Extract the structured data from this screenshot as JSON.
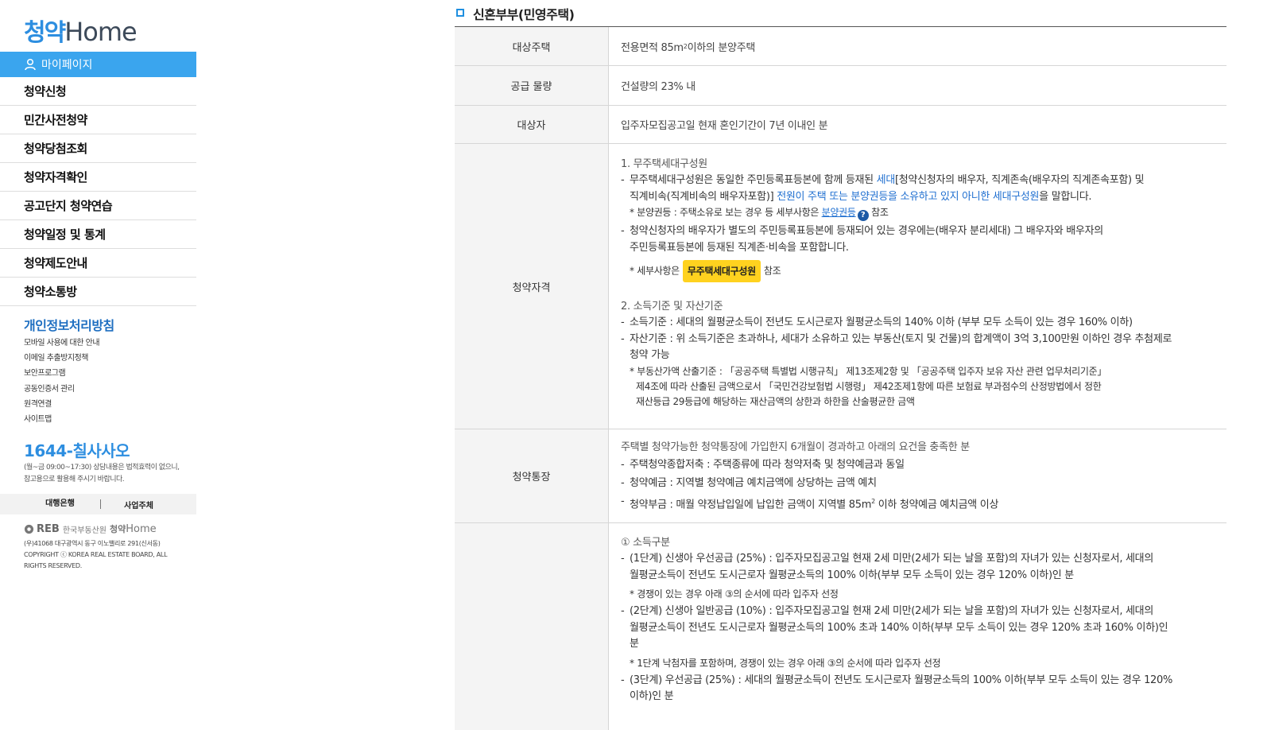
{
  "logo": {
    "ko": "청약",
    "en": "Home"
  },
  "sidebar": {
    "mypage_label": "마이페이지",
    "menu": [
      "청약신청",
      "민간사전청약",
      "청약당첨조회",
      "청약자격확인",
      "공고단지 청약연습",
      "청약일정 및 통계",
      "청약제도안내",
      "청약소통방"
    ],
    "privacy_title": "개인정보처리방침",
    "sublinks": [
      "모바일 사용에 대한 안내",
      "이메일 추출방지정책",
      "보안프로그램",
      "공동인증서 관리",
      "원격연결",
      "사이트맵"
    ],
    "phone": "1644-칠사사오",
    "phone_note": "(월~금 09:00~17:30) 상담내용은 법적효력이 없으니, 참고용으로 활용해 주시기 바랍니다.",
    "bank_label": "대행은행",
    "developer_label": "사업주체",
    "footer_logo": {
      "reb": "REB",
      "org": "한국부동산원",
      "ko": "청약",
      "en": "Home"
    },
    "address": "(우)41068 대구광역시 동구 이노밸리로 291(신서동)",
    "copyright": "COPYRIGHT ⓒ KOREA REAL ESTATE BOARD, ALL RIGHTS RESERVED."
  },
  "main": {
    "section_title": "신혼부부(민영주택)",
    "rows": {
      "target_housing": {
        "th": "대상주택",
        "text_a": "전용면적 85m",
        "sup": "2",
        "text_b": " 이하의 분양주택"
      },
      "supply": {
        "th": "공급 물량",
        "text": "건설량의 23% 내"
      },
      "target": {
        "th": "대상자",
        "text": "입주자모집공고일 현재 혼인기간이 7년 이내인 분"
      },
      "qual": {
        "th": "청약자격",
        "h1": "1. 무주택세대구성원",
        "b1_a": "무주택세대구성원은 동일한 주민등록표등본에 함께 등재된 ",
        "b1_link": "세대",
        "b1_b": "[청약신청자의 배우자, 직계존속(배우자의 직계존속포함) 및",
        "b1_c": "직계비속(직계비속의 배우자포함)] ",
        "b1_link2": "전원이 주택 또는 분양권등을 소유하고 있지 아니한 세대구성원",
        "b1_d": "을 말합니다.",
        "n1_a": "* 분양권등 : 주택소유로 보는 경우 등 세부사항은 ",
        "n1_link": "분양권등",
        "n1_q": "?",
        "n1_b": " 참조",
        "b2_a": "청약신청자의 배우자가 별도의 주민등록표등본에 등재되어 있는 경우에는(배우자 분리세대) 그 배우자와 배우자의",
        "b2_b": "주민등록표등본에 등재된 직계존·비속을 포함합니다.",
        "n2_a": "* 세부사항은",
        "n2_btn": "무주택세대구성원",
        "n2_b": "참조",
        "h2": "2. 소득기준 및 자산기준",
        "b3": "소득기준 : 세대의 월평균소득이 전년도 도시근로자 월평균소득의 140% 이하 (부부 모두 소득이 있는 경우 160% 이하)",
        "b4_a": "자산기준 : 위 소득기준은 초과하나, 세대가 소유하고 있는 부동산(토지 및 건물)의 합계액이 3억 3,100만원 이하인 경우 추첨제로",
        "b4_b": "청약 가능",
        "n3_a": "* 부동산가액 산출기준 : 「공공주택 특별법 시행규칙」 제13조제2항 및 「공공주택 입주자 보유 자산 관련 업무처리기준」",
        "n3_b": "제4조에 따라 산출된 금액으로서 「국민건강보험법 시행령」 제42조제1항에 따른 보험료 부과점수의 산정방법에서 정한",
        "n3_c": "재산등급 29등급에 해당하는 재산금액의 상한과 하한을 산술평균한 금액"
      },
      "account": {
        "th": "청약통장",
        "intro": "주택별 청약가능한 청약통장에 가입한지 6개월이 경과하고 아래의 요건을 충족한 분",
        "b1": "주택청약종합저축 : 주택종류에 따라 청약저축 및 청약예금과 동일",
        "b2": "청약예금 : 지역별 청약예금 예치금액에 상당하는 금액 예치",
        "b3_a": "청약부금 : 매월 약정납입일에 납입한 금액이 지역별 85m",
        "b3_sup": "2",
        "b3_b": " 이하 청약예금 예치금액 이상"
      },
      "income": {
        "h1": "① 소득구분",
        "b1_a": "(1단계) 신생아 우선공급 (25%) : 입주자모집공고일 현재 2세 미만(2세가 되는 날을 포함)의 자녀가 있는 신청자로서, 세대의",
        "b1_b": "월평균소득이 전년도 도시근로자 월평균소득의 100% 이하(부부 모두 소득이 있는 경우 120% 이하)인 분",
        "n1": "* 경쟁이 있는 경우 아래 ③의 순서에 따라 입주자 선정",
        "b2_a": "(2단계) 신생아 일반공급 (10%) : 입주자모집공고일 현재 2세 미만(2세가 되는 날을 포함)의 자녀가 있는 신청자로서, 세대의",
        "b2_b": "월평균소득이 전년도 도시근로자 월평균소득의 100% 초과 140% 이하(부부 모두 소득이 있는 경우 120% 초과 160% 이하)인",
        "b2_c": "분",
        "n2": "* 1단계 낙첨자를 포함하며, 경쟁이 있는 경우 아래 ③의 순서에 따라 입주자 선정",
        "b3_a": "(3단계) 우선공급 (25%) : 세대의 월평균소득이 전년도 도시근로자 월평균소득의 100% 이하(부부 모두 소득이 있는 경우 120%",
        "b3_b": "이하)인 분"
      }
    }
  },
  "colors": {
    "accent": "#3aa5ee",
    "link": "#1f6fd0",
    "highlight": "#ffd21f",
    "header_bg": "#f4f4f4"
  }
}
